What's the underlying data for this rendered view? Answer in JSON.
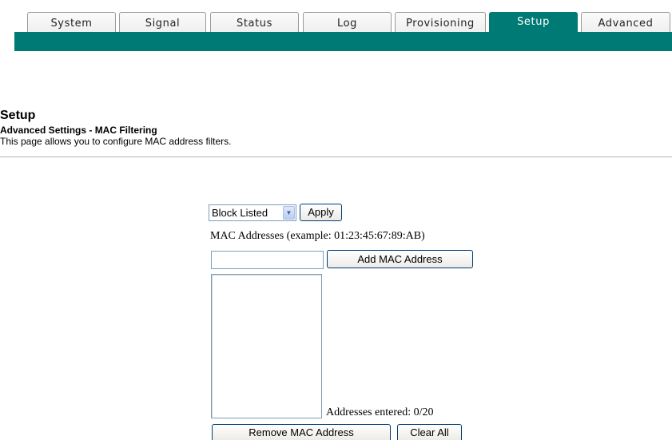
{
  "nav": {
    "tabs": [
      {
        "label": "System"
      },
      {
        "label": "Signal"
      },
      {
        "label": "Status"
      },
      {
        "label": "Log"
      },
      {
        "label": "Provisioning"
      },
      {
        "label": "Setup"
      },
      {
        "label": "Advanced"
      }
    ],
    "active_tab": "Setup"
  },
  "header": {
    "title": "Setup",
    "subtitle": "Advanced Settings - MAC Filtering",
    "description": "This page allows you to configure MAC address filters."
  },
  "filter": {
    "mode_selected": "Block Listed",
    "apply_label": "Apply"
  },
  "mac": {
    "label": "MAC Addresses (example: 01:23:45:67:89:AB)",
    "input_value": "",
    "add_label": "Add MAC Address",
    "addresses": [],
    "count_text": "Addresses entered: 0/20",
    "remove_label": "Remove MAC Address",
    "clear_label": "Clear All"
  },
  "colors": {
    "accent": "#007a74",
    "tab_bg": "#f4f4f4",
    "divider": "#b5b5b5"
  }
}
